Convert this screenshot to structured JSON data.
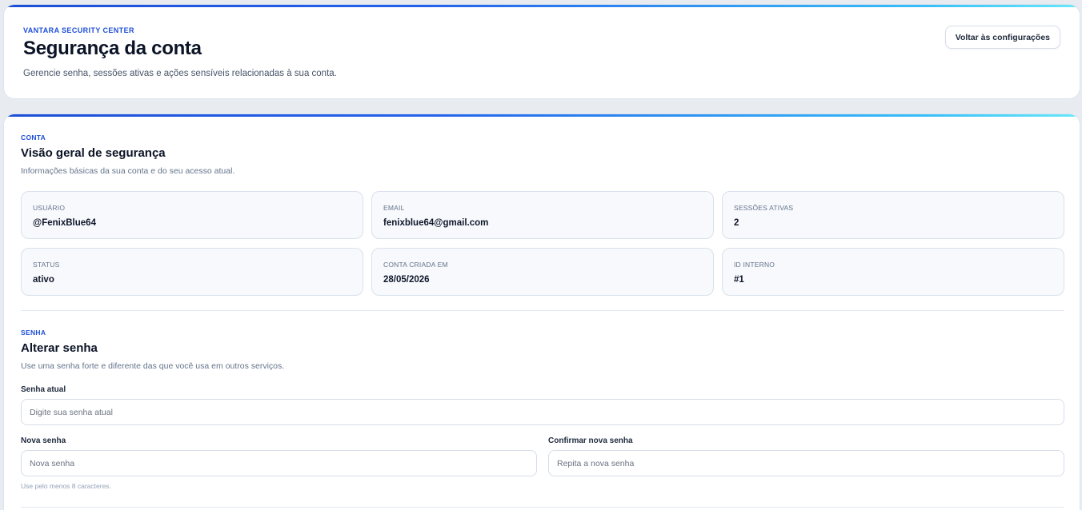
{
  "header": {
    "eyebrow": "VANTARA SECURITY CENTER",
    "title": "Segurança da conta",
    "subtitle": "Gerencie senha, sessões ativas e ações sensíveis relacionadas à sua conta.",
    "back_label": "Voltar às configurações"
  },
  "overview": {
    "eyebrow": "CONTA",
    "title": "Visão geral de segurança",
    "description": "Informações básicas da sua conta e do seu acesso atual.",
    "items": [
      {
        "label": "USUÁRIO",
        "value": "@FenixBlue64"
      },
      {
        "label": "EMAIL",
        "value": "fenixblue64@gmail.com"
      },
      {
        "label": "SESSÕES ATIVAS",
        "value": "2"
      },
      {
        "label": "STATUS",
        "value": "ativo"
      },
      {
        "label": "CONTA CRIADA EM",
        "value": "28/05/2026"
      },
      {
        "label": "ID INTERNO",
        "value": "#1"
      }
    ]
  },
  "password": {
    "eyebrow": "SENHA",
    "title": "Alterar senha",
    "description": "Use uma senha forte e diferente das que você usa em outros serviços.",
    "current_label": "Senha atual",
    "current_placeholder": "Digite sua senha atual",
    "new_label": "Nova senha",
    "new_placeholder": "Nova senha",
    "confirm_label": "Confirmar nova senha",
    "confirm_placeholder": "Repita a nova senha",
    "hint": "Use pelo menos 8 caracteres."
  },
  "colors": {
    "accent": "#1d4ed8",
    "accent_gradient_end": "#67e8f9",
    "background": "#e8ecf1"
  }
}
